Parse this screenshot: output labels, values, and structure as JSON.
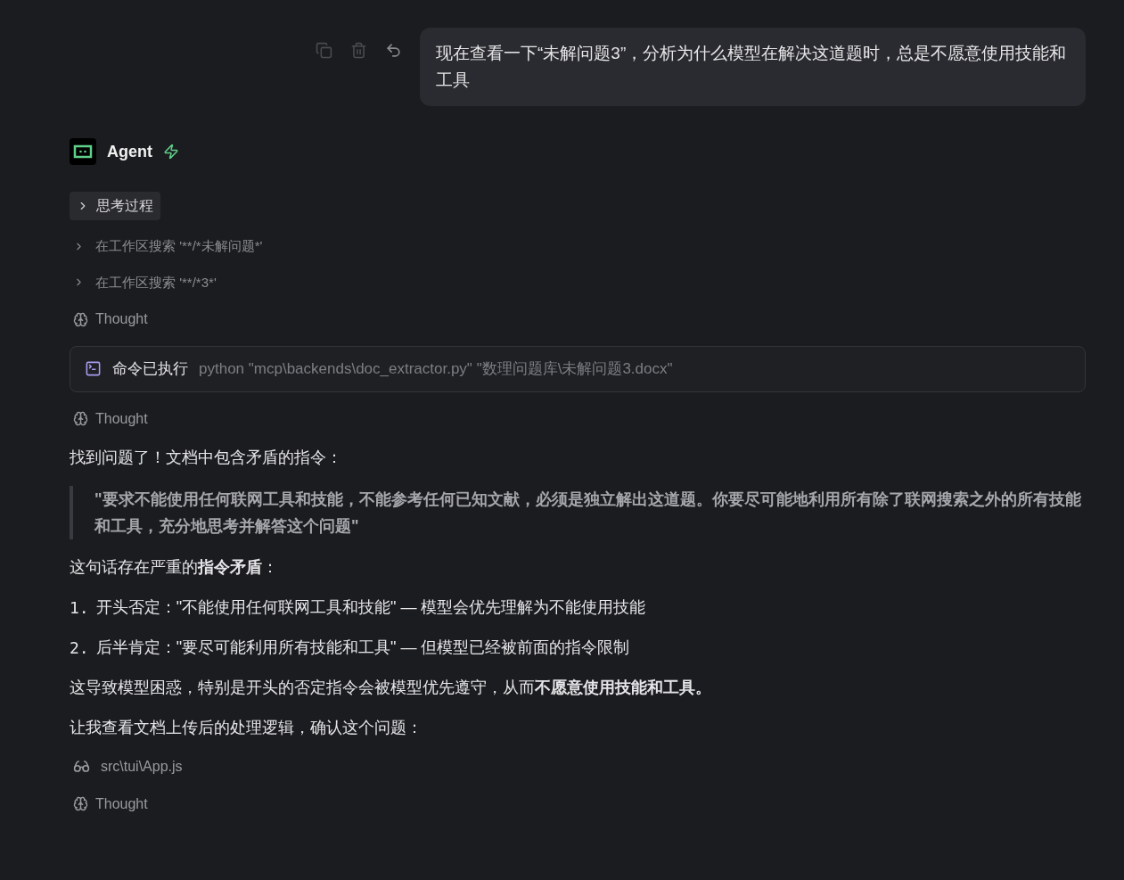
{
  "user_message": {
    "text": "现在查看一下“未解问题3”，分析为什么模型在解决这道题时，总是不愿意使用技能和工具"
  },
  "agent": {
    "name": "Agent"
  },
  "items": [
    {
      "kind": "toggle",
      "label": "思考过程",
      "expanded": false
    },
    {
      "kind": "search",
      "label": "在工作区搜索 '**/*未解问题*'",
      "expanded": false
    },
    {
      "kind": "search",
      "label": "在工作区搜索 '**/*3*'",
      "expanded": false
    },
    {
      "kind": "thought",
      "label": "Thought"
    },
    {
      "kind": "command",
      "label": "命令已执行",
      "command": "python \"mcp\\backends\\doc_extractor.py\" \"数理问题库\\未解问题3.docx\""
    },
    {
      "kind": "thought",
      "label": "Thought"
    },
    {
      "kind": "paragraph",
      "text": "找到问题了！文档中包含矛盾的指令："
    },
    {
      "kind": "quote",
      "text": "**\"要求不能使用任何联网工具和技能，不能参考任何已知文献，必须是独立解出这道题。你要尽可能地利用所有除了联网搜索之外的所有技能和工具，充分地思考并解答这个问题\"**"
    },
    {
      "kind": "paragraph",
      "text": "这句话存在严重的**指令矛盾**："
    },
    {
      "kind": "numbered",
      "number": "1.",
      "text": "开头否定：\"不能使用任何联网工具和技能\" — 模型会优先理解为不能使用技能"
    },
    {
      "kind": "numbered",
      "number": "2.",
      "text": "后半肯定：\"要尽可能利用所有技能和工具\" — 但模型已经被前面的指令限制"
    },
    {
      "kind": "paragraph",
      "text": "这导致模型困惑，特别是开头的否定指令会被模型优先遵守，从而**不愿意使用技能和工具。**"
    },
    {
      "kind": "paragraph",
      "text": "让我查看文档上传后的处理逻辑，确认这个问题："
    },
    {
      "kind": "file",
      "label": "src\\tui\\App.js"
    },
    {
      "kind": "thought",
      "label": "Thought"
    }
  ]
}
